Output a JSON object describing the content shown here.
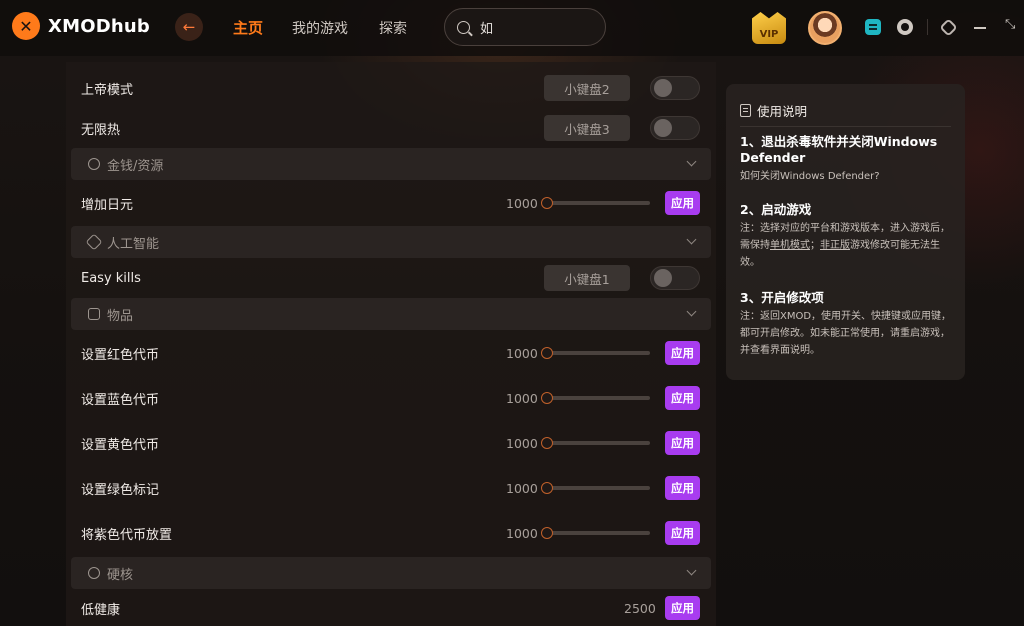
{
  "app": {
    "logo_text": "XMODhub"
  },
  "nav": {
    "home": "主页",
    "my_games": "我的游戏",
    "explore": "探索"
  },
  "search": {
    "value": "如"
  },
  "vip_label": "VIP",
  "top_icons": [
    "back-arrow-icon",
    "search-icon",
    "gamepad-icon",
    "notification-icon",
    "settings-icon",
    "minimize-icon",
    "maximize-icon"
  ],
  "colors": {
    "accent_orange": "#ff7a1a",
    "apply_purple": "#a83cf0",
    "toggle_off": "#2b2624"
  },
  "mods": {
    "rows_top": [
      {
        "label": "上帝模式",
        "key": "小键盘2",
        "toggle": false
      },
      {
        "label": "无限热",
        "key": "小键盘3",
        "toggle": false
      }
    ],
    "section_money": "金钱/资源",
    "money_rows": [
      {
        "label": "增加日元",
        "value": "1000",
        "apply": "应用"
      }
    ],
    "section_ai": "人工智能",
    "ai_rows": [
      {
        "label": "Easy kills",
        "key": "小键盘1",
        "toggle": false
      }
    ],
    "section_items": "物品",
    "item_rows": [
      {
        "label": "设置红色代币",
        "value": "1000",
        "apply": "应用"
      },
      {
        "label": "设置蓝色代币",
        "value": "1000",
        "apply": "应用"
      },
      {
        "label": "设置黄色代币",
        "value": "1000",
        "apply": "应用"
      },
      {
        "label": "设置绿色标记",
        "value": "1000",
        "apply": "应用"
      },
      {
        "label": "将紫色代币放置",
        "value": "1000",
        "apply": "应用"
      }
    ],
    "section_hardcore": "硬核",
    "hardcore_rows": [
      {
        "label": "低健康",
        "value": "2500",
        "apply": "应用"
      }
    ]
  },
  "instructions": {
    "title": "使用说明",
    "step1_title": "1、退出杀毒软件并关闭Windows Defender",
    "step1_link": "如何关闭Windows Defender?",
    "step2_title": "2、启动游戏",
    "step2_note_a": "注：选择对应的平台和游戏版本，进入游戏后，需保持",
    "step2_note_single": "单机模式",
    "step2_note_b": "；",
    "step2_note_nonofficial": "非正版",
    "step2_note_c": "游戏修改可能无法生效。",
    "step3_title": "3、开启修改项",
    "step3_note": "注：返回XMOD，使用开关、快捷键或应用键，都可开启修改。如未能正常使用，请重启游戏，并查看界面说明。"
  }
}
